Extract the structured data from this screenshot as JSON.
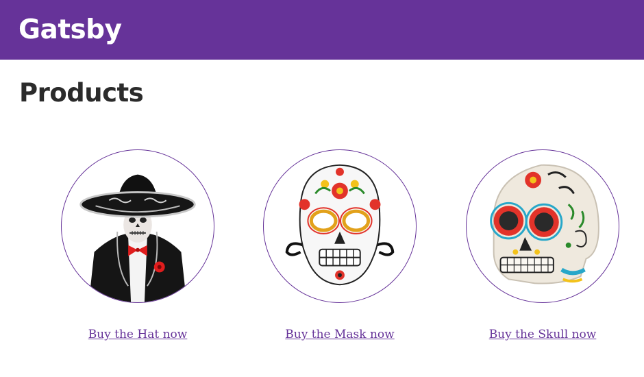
{
  "header": {
    "site_title": "Gatsby",
    "brand_color": "#663399"
  },
  "main": {
    "page_title": "Products",
    "products": [
      {
        "name": "Hat",
        "image_icon": "sombrero-costume-icon",
        "buy_label": "Buy the Hat now"
      },
      {
        "name": "Mask",
        "image_icon": "sugar-skull-mask-icon",
        "buy_label": "Buy the Mask now"
      },
      {
        "name": "Skull",
        "image_icon": "sugar-skull-icon",
        "buy_label": "Buy the Skull now"
      }
    ]
  }
}
